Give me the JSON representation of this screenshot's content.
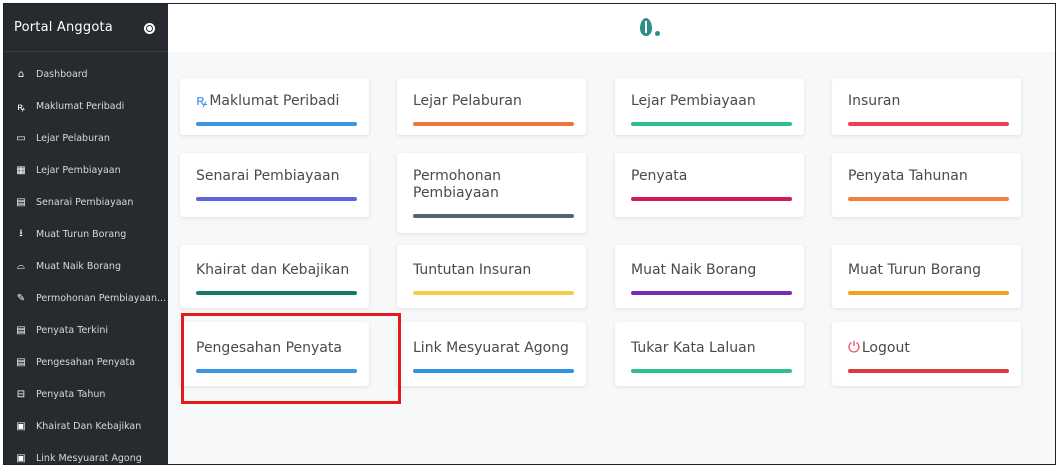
{
  "sidebar": {
    "title": "Portal Anggota",
    "items": [
      {
        "label": "Dashboard",
        "icon": "⌂"
      },
      {
        "label": "Maklumat Peribadi",
        "icon": "ꝶ"
      },
      {
        "label": "Lejar Pelaburan",
        "icon": "▭"
      },
      {
        "label": "Lejar Pembiayaan",
        "icon": "▦"
      },
      {
        "label": "Senarai Pembiayaan",
        "icon": "▤"
      },
      {
        "label": "Muat Turun Borang",
        "icon": "⭳"
      },
      {
        "label": "Muat Naik Borang",
        "icon": "⌓"
      },
      {
        "label": "Permohonan Pembiayaan...",
        "icon": "✎"
      },
      {
        "label": "Penyata Terkini",
        "icon": "▤"
      },
      {
        "label": "Pengesahan Penyata",
        "icon": "▤"
      },
      {
        "label": "Penyata Tahun",
        "icon": "⊟"
      },
      {
        "label": "Khairat Dan Kebajikan",
        "icon": "▣"
      },
      {
        "label": "Link Mesyuarat Agong",
        "icon": "▣"
      }
    ]
  },
  "cards": [
    {
      "label": "Maklumat Peribadi",
      "icon": "ꝶ",
      "color": "#3a95e2"
    },
    {
      "label": "Lejar Pelaburan",
      "color": "#f0743c"
    },
    {
      "label": "Lejar Pembiayaan",
      "color": "#2cc18b"
    },
    {
      "label": "Insuran",
      "color": "#ef3f56"
    },
    {
      "label": "Senarai Pembiayaan",
      "color": "#5a63e0"
    },
    {
      "label": "Permohonan Pembiayaan",
      "color": "#566470"
    },
    {
      "label": "Penyata",
      "color": "#d21a5b"
    },
    {
      "label": "Penyata Tahunan",
      "color": "#f5803e"
    },
    {
      "label": "Khairat dan Kebajikan",
      "color": "#147a6b"
    },
    {
      "label": "Tuntutan Insuran",
      "color": "#f5cd48"
    },
    {
      "label": "Muat Naik Borang",
      "color": "#7b2ab4"
    },
    {
      "label": "Muat Turun Borang",
      "color": "#f3a21d"
    },
    {
      "label": "Pengesahan Penyata",
      "color": "#3a95e2"
    },
    {
      "label": "Link Mesyuarat Agong",
      "color": "#2b93e4"
    },
    {
      "label": "Tukar Kata Laluan",
      "color": "#2cc18b"
    },
    {
      "label": "Logout",
      "icon": "⏻",
      "color": "#dc3a3e"
    }
  ]
}
